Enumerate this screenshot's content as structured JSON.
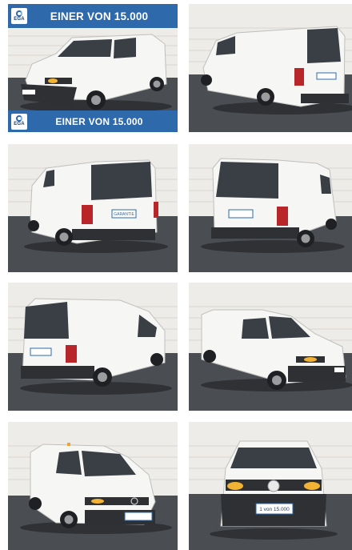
{
  "banner": {
    "top_text": "EINER VON 15.000",
    "bottom_text": "EINER VON 15.000",
    "logo_text": "EGA",
    "color": "#2e69ab"
  },
  "badges": {
    "garantie": "GARANTIE",
    "plate_front": "1 von 15.000"
  },
  "photos": [
    {
      "view": "front-left"
    },
    {
      "view": "rear-right"
    },
    {
      "view": "rear-left"
    },
    {
      "view": "rear-right"
    },
    {
      "view": "rear-left"
    },
    {
      "view": "front-right"
    },
    {
      "view": "front-left"
    },
    {
      "view": "front"
    }
  ],
  "colors": {
    "wall": "#eeece8",
    "floor": "#4a4d52",
    "van_body": "#f6f6f4",
    "glass": "#3a3f46"
  }
}
